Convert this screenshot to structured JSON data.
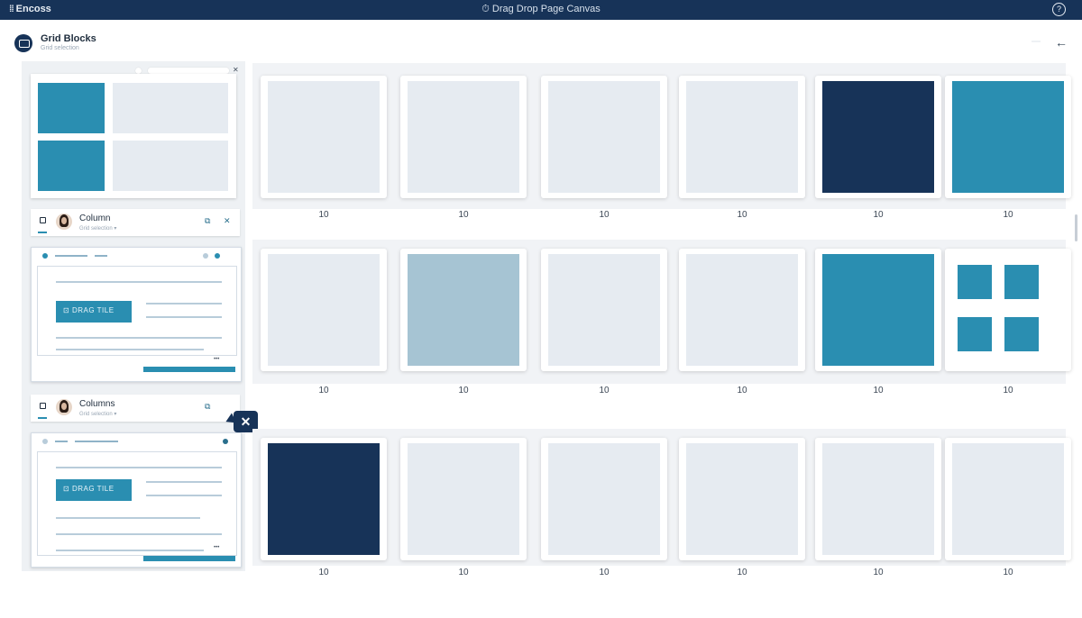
{
  "window": {
    "brand": "Encoss",
    "title": "Drag Drop Page Canvas"
  },
  "header": {
    "title": "Grid Blocks",
    "subtitle": "Grid selection"
  },
  "sidebar": {
    "components": [
      {
        "name": "Column",
        "meta": "Grid selection"
      },
      {
        "name": "Columns",
        "meta": "Grid selection"
      }
    ],
    "panel_buttons": [
      "DRAG TILE",
      "DRAG TILE"
    ]
  },
  "canvas": {
    "rows": [
      {
        "cards": [
          {
            "color": "#e6ebf1",
            "label": "10"
          },
          {
            "color": "#e6ebf1",
            "label": "10"
          },
          {
            "color": "#e6ebf1",
            "label": "10"
          },
          {
            "color": "#e6ebf1",
            "label": "10"
          },
          {
            "color": "#173358",
            "label": "10"
          },
          {
            "color": "#2a8eb1",
            "label": "10"
          }
        ]
      },
      {
        "cards": [
          {
            "color": "#e6ebf1",
            "label": "10"
          },
          {
            "color": "#a6c4d3",
            "label": "10"
          },
          {
            "color": "#e6ebf1",
            "label": "10"
          },
          {
            "color": "#e6ebf1",
            "label": "10"
          },
          {
            "color": "#2a8eb1",
            "label": "10"
          },
          {
            "color": "grid-4",
            "label": "10"
          }
        ]
      },
      {
        "cards": [
          {
            "color": "#173358",
            "label": "10"
          },
          {
            "color": "#e6ebf1",
            "label": "10"
          },
          {
            "color": "#e6ebf1",
            "label": "10"
          },
          {
            "color": "#e6ebf1",
            "label": "10"
          },
          {
            "color": "#e6ebf1",
            "label": "10"
          },
          {
            "color": "#e6ebf1",
            "label": "10"
          }
        ]
      }
    ]
  },
  "colors": {
    "dark": "#173358",
    "teal": "#2a8eb1",
    "light": "#e6ebf1",
    "mid": "#a6c4d3"
  }
}
